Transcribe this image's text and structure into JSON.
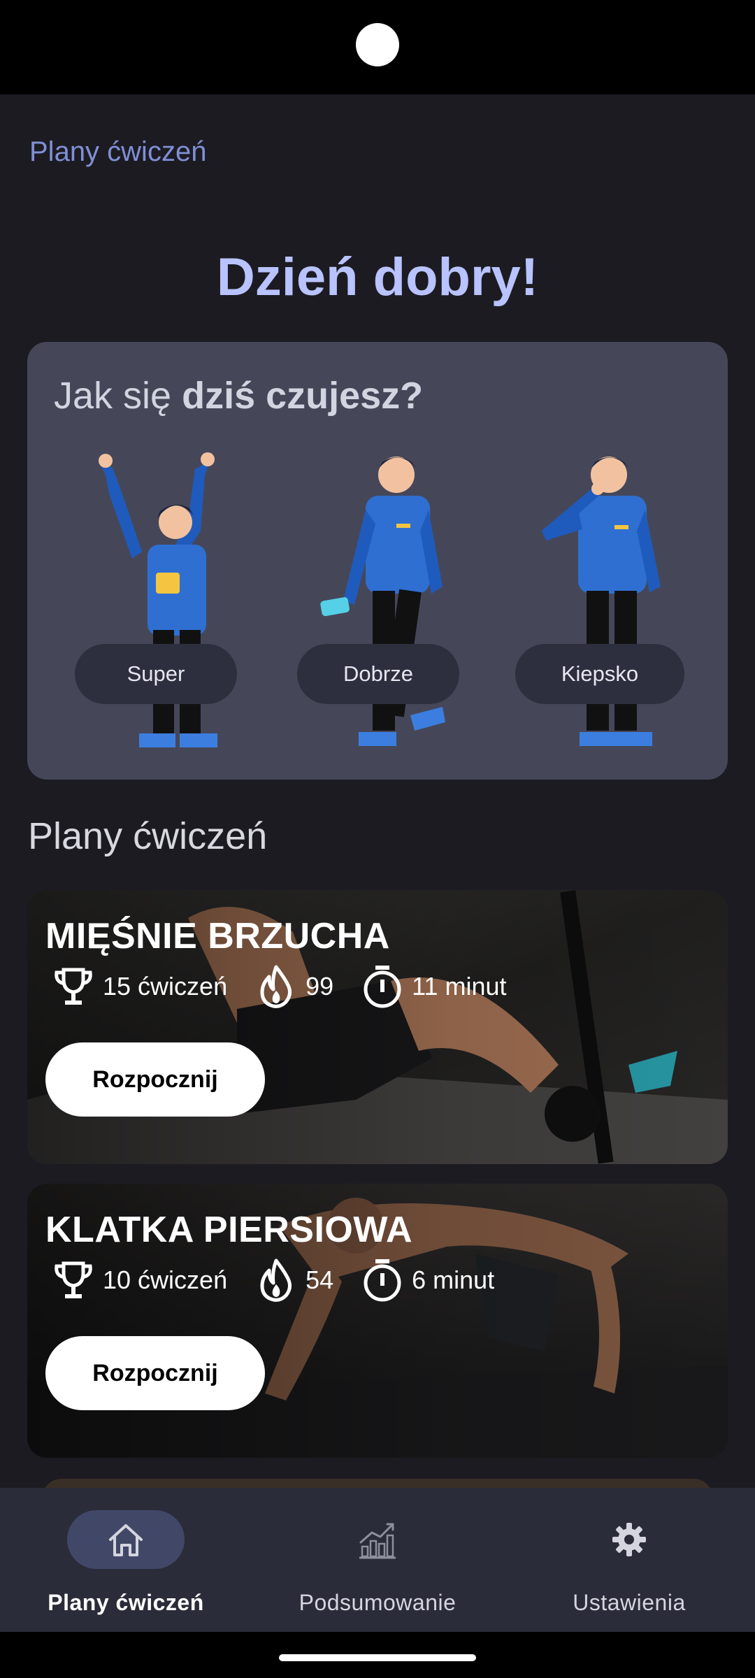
{
  "app": {
    "title": "Plany ćwiczeń",
    "greeting": "Dzień dobry!"
  },
  "mood": {
    "question_prefix": "Jak się ",
    "question_bold": "dziś czujesz?",
    "options": [
      {
        "label": "Super",
        "icon": "person-celebrating-illustration"
      },
      {
        "label": "Dobrze",
        "icon": "person-holding-phone-illustration"
      },
      {
        "label": "Kiepsko",
        "icon": "person-thinking-illustration"
      }
    ]
  },
  "plans_section": {
    "title": "Plany ćwiczeń",
    "plans": [
      {
        "title": "MIĘŚNIE BRZUCHA",
        "exercises": "15 ćwiczeń",
        "calories": "99",
        "duration": "11 minut",
        "button": "Rozpocznij"
      },
      {
        "title": "KLATKA PIERSIOWA",
        "exercises": "10 ćwiczeń",
        "calories": "54",
        "duration": "6 minut",
        "button": "Rozpocznij"
      }
    ]
  },
  "nav": {
    "items": [
      {
        "label": "Plany ćwiczeń",
        "icon": "home-icon",
        "active": true
      },
      {
        "label": "Podsumowanie",
        "icon": "chart-icon",
        "active": false
      },
      {
        "label": "Ustawienia",
        "icon": "gear-icon",
        "active": false
      }
    ]
  },
  "colors": {
    "background": "#1c1b21",
    "accent": "#b8c3ff",
    "card": "#454759",
    "nav_bg": "#2b2c39"
  }
}
